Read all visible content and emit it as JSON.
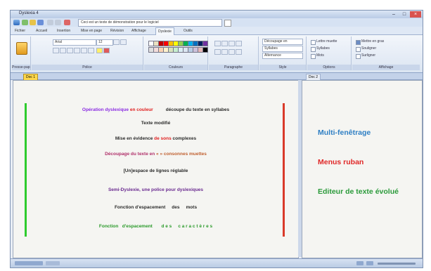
{
  "window": {
    "title": "Dyslexia 4"
  },
  "qat": {
    "field_text": "Ceci est un texte de démonstration pour le logiciel"
  },
  "ribbon": {
    "tabs": [
      "Fichier",
      "Accueil",
      "Insertion",
      "Mise en page",
      "Révision",
      "Affichage",
      "Dyslexie",
      "Outils"
    ],
    "active_tab": 6,
    "groups": [
      "Presse-papiers",
      "Police",
      "Couleurs",
      "Paragraphe",
      "Style",
      "Options",
      "Affichage"
    ],
    "font_name": "Arial",
    "font_size": "12",
    "dropdowns": [
      "Découpage en",
      "Syllabes",
      "Alternance"
    ],
    "checks": [
      "Lettre muette",
      "Syllabes",
      "Mots",
      "Mettre en gras",
      "Souligner",
      "Surligner"
    ],
    "swatch_colors": [
      "#ffffff",
      "#e8e0c0",
      "#c00000",
      "#ff0000",
      "#ffc000",
      "#ffff00",
      "#92d050",
      "#00b050",
      "#00b0f0",
      "#0070c0",
      "#002060",
      "#7030a0",
      "#e0e0e0",
      "#f2dcdb",
      "#fbd4b4",
      "#fff2cc",
      "#d8e4bc",
      "#c6efce",
      "#daeef3",
      "#dce6f1",
      "#b8cce4",
      "#ccc0da",
      "#e6b8b7",
      "#000000"
    ],
    "accent_color": "#6b8cc4"
  },
  "doc_tabs": {
    "active": "Doc 1",
    "other": "Doc 2"
  },
  "document": {
    "bar_left_color": "#2ecc2e",
    "bar_right_color": "#d93a2a",
    "lines": [
      {
        "parts": [
          {
            "text": "Opération dyslexique ",
            "color": "#8a2be2"
          },
          {
            "text": "en couleur",
            "color": "#e02020"
          },
          {
            "text": "          découpe du texte en syllabes",
            "color": "#2a2a2a"
          }
        ]
      },
      {
        "parts": [
          {
            "text": "Texte modifié",
            "color": "#2a2a2a"
          }
        ]
      },
      {
        "parts": [
          {
            "text": "Mise en évidence ",
            "color": "#2a2a2a"
          },
          {
            "text": "de sons",
            "color": "#e02020"
          },
          {
            "text": " complexes",
            "color": "#2a2a2a"
          }
        ]
      },
      {
        "parts": [
          {
            "text": "Découpage du texte en ",
            "color": "#b0306a"
          },
          {
            "text": "« » consonnes muettes",
            "color": "#c06030"
          }
        ]
      },
      {
        "parts": [
          {
            "text": "[Un]espace de lignes réglable",
            "color": "#2a2a2a"
          }
        ]
      },
      {
        "parts": [
          {
            "text": "Semi-Dyslexie, une police pour dyslexiques",
            "color": "#6a2a90"
          }
        ]
      },
      {
        "parts": [
          {
            "text": "Fonction d'espacement     des     mots",
            "color": "#2a2a2a"
          }
        ]
      },
      {
        "parts": [
          {
            "text": "Fonction   d'espacement",
            "color": "#2a9a2a"
          },
          {
            "text": "       d e s     c a r a c t è r e s",
            "color": "#2a9a2a"
          }
        ]
      }
    ]
  },
  "features": [
    {
      "text": "Multi-fenêtrage",
      "color": "#2f7fc4"
    },
    {
      "text": "Menus ruban",
      "color": "#e02828"
    },
    {
      "text": "Editeur de texte évolué",
      "color": "#2a9a3a"
    }
  ]
}
